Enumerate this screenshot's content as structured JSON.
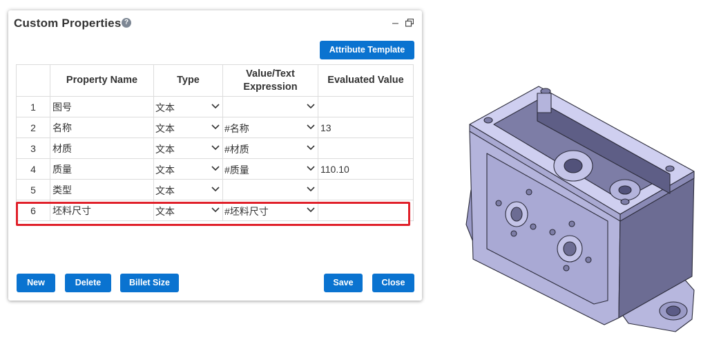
{
  "panel": {
    "title": "Custom Properties",
    "help_glyph": "?",
    "minimize_glyph": "–"
  },
  "toolbar": {
    "attribute_template_label": "Attribute Template"
  },
  "table": {
    "headers": {
      "index": "",
      "property_name": "Property Name",
      "type": "Type",
      "value_line1": "Value/Text",
      "value_line2": "Expression",
      "evaluated": "Evaluated Value"
    },
    "rows": [
      {
        "index": "1",
        "name": "图号",
        "type": "文本",
        "value": "",
        "evaluated": ""
      },
      {
        "index": "2",
        "name": "名称",
        "type": "文本",
        "value": "#名称",
        "evaluated": "13"
      },
      {
        "index": "3",
        "name": "材质",
        "type": "文本",
        "value": "#材质",
        "evaluated": ""
      },
      {
        "index": "4",
        "name": "质量",
        "type": "文本",
        "value": "#质量",
        "evaluated": "110.10"
      },
      {
        "index": "5",
        "name": "类型",
        "type": "文本",
        "value": "",
        "evaluated": ""
      },
      {
        "index": "6",
        "name": "坯料尺寸",
        "type": "文本",
        "value": "#坯料尺寸",
        "evaluated": ""
      }
    ]
  },
  "footer": {
    "new_label": "New",
    "delete_label": "Delete",
    "billet_size_label": "Billet Size",
    "save_label": "Save",
    "close_label": "Close"
  },
  "colors": {
    "accent": "#0a73d0",
    "highlight": "#e0202a",
    "model_face": "#b4b4dc"
  }
}
